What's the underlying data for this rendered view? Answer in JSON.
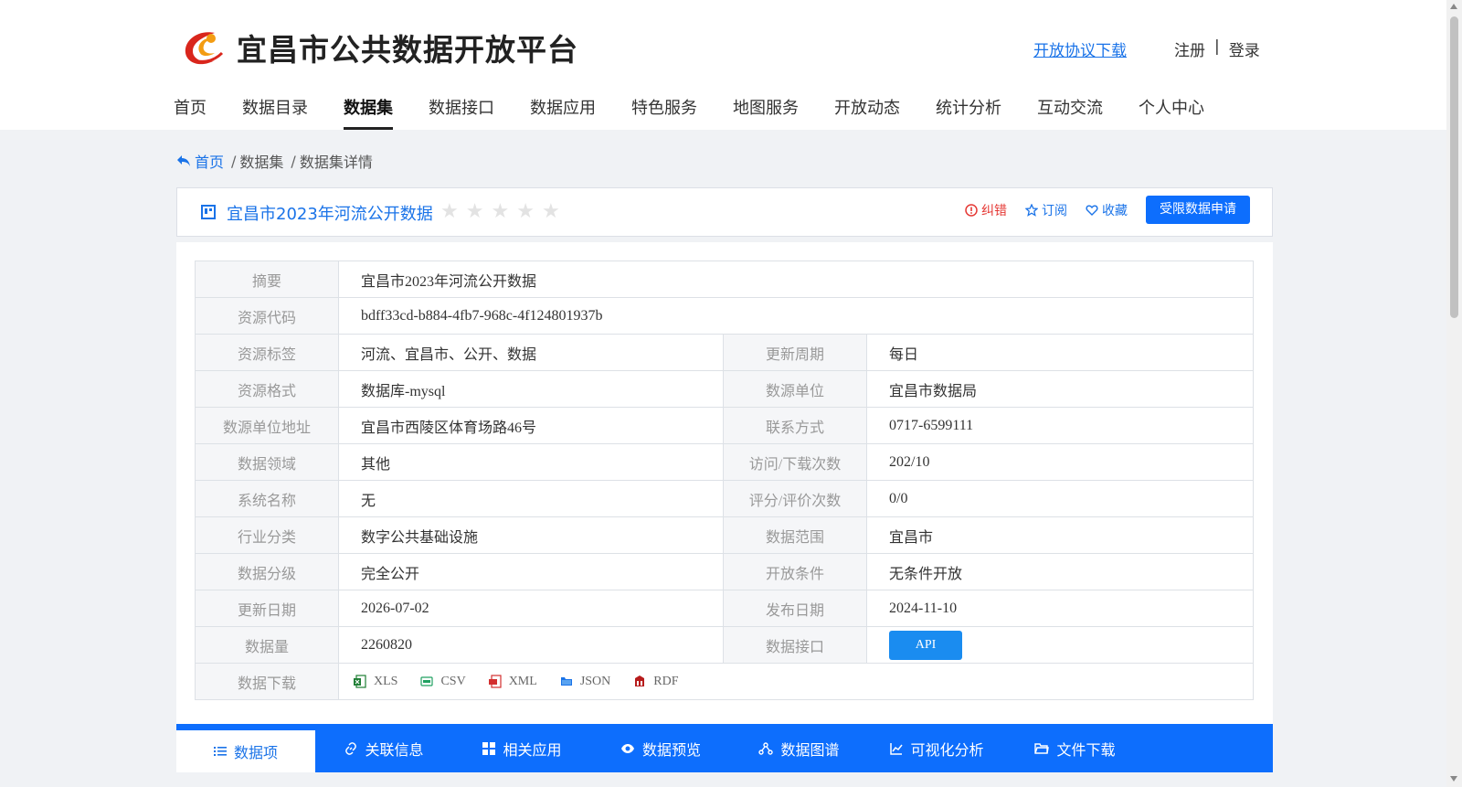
{
  "header": {
    "site_title": "宜昌市公共数据开放平台",
    "agreement_link": "开放协议下载",
    "register": "注册",
    "divider": "|",
    "login": "登录"
  },
  "nav": [
    {
      "label": "首页",
      "active": false
    },
    {
      "label": "数据目录",
      "active": false
    },
    {
      "label": "数据集",
      "active": true
    },
    {
      "label": "数据接口",
      "active": false
    },
    {
      "label": "数据应用",
      "active": false
    },
    {
      "label": "特色服务",
      "active": false
    },
    {
      "label": "地图服务",
      "active": false
    },
    {
      "label": "开放动态",
      "active": false
    },
    {
      "label": "统计分析",
      "active": false
    },
    {
      "label": "互动交流",
      "active": false
    },
    {
      "label": "个人中心",
      "active": false
    }
  ],
  "breadcrumb": {
    "home": "首页",
    "level1": "数据集",
    "level2": "数据集详情",
    "sep": "/"
  },
  "dataset": {
    "title": "宜昌市2023年河流公开数据",
    "rating_stars": 0,
    "actions": {
      "report": "纠错",
      "subscribe": "订阅",
      "favorite": "收藏",
      "apply": "受限数据申请"
    }
  },
  "info": {
    "summary": {
      "label": "摘要",
      "value": "宜昌市2023年河流公开数据"
    },
    "resource_code": {
      "label": "资源代码",
      "value": "bdff33cd-b884-4fb7-968c-4f124801937b"
    },
    "rows": [
      [
        {
          "label": "资源标签",
          "value": "河流、宜昌市、公开、数据"
        },
        {
          "label": "更新周期",
          "value": "每日"
        }
      ],
      [
        {
          "label": "资源格式",
          "value": "数据库-mysql"
        },
        {
          "label": "数源单位",
          "value": "宜昌市数据局"
        }
      ],
      [
        {
          "label": "数源单位地址",
          "value": "宜昌市西陵区体育场路46号"
        },
        {
          "label": "联系方式",
          "value": "0717-6599111"
        }
      ],
      [
        {
          "label": "数据领域",
          "value": "其他"
        },
        {
          "label": "访问/下载次数",
          "value": "202/10"
        }
      ],
      [
        {
          "label": "系统名称",
          "value": "无"
        },
        {
          "label": "评分/评价次数",
          "value": "0/0"
        }
      ],
      [
        {
          "label": "行业分类",
          "value": "数字公共基础设施"
        },
        {
          "label": "数据范围",
          "value": "宜昌市"
        }
      ],
      [
        {
          "label": "数据分级",
          "value": "完全公开"
        },
        {
          "label": "开放条件",
          "value": "无条件开放"
        }
      ],
      [
        {
          "label": "更新日期",
          "value": "2026-07-02"
        },
        {
          "label": "发布日期",
          "value": "2024-11-10"
        }
      ]
    ],
    "data_volume": {
      "label": "数据量",
      "value": "2260820"
    },
    "data_api": {
      "label": "数据接口",
      "button": "API"
    },
    "download": {
      "label": "数据下载",
      "formats": [
        {
          "name": "XLS",
          "icon": "xls-icon",
          "color": "#1e7e34"
        },
        {
          "name": "CSV",
          "icon": "csv-icon",
          "color": "#20a060"
        },
        {
          "name": "XML",
          "icon": "xml-icon",
          "color": "#d32f2f"
        },
        {
          "name": "JSON",
          "icon": "json-icon",
          "color": "#1a73e8"
        },
        {
          "name": "RDF",
          "icon": "rdf-icon",
          "color": "#b71c1c"
        }
      ]
    }
  },
  "tabs": [
    {
      "label": "数据项",
      "icon": "list-icon",
      "active": true
    },
    {
      "label": "关联信息",
      "icon": "link-icon",
      "active": false
    },
    {
      "label": "相关应用",
      "icon": "grid-icon",
      "active": false
    },
    {
      "label": "数据预览",
      "icon": "eye-icon",
      "active": false
    },
    {
      "label": "数据图谱",
      "icon": "graph-icon",
      "active": false
    },
    {
      "label": "可视化分析",
      "icon": "line-chart-icon",
      "active": false
    },
    {
      "label": "文件下载",
      "icon": "folder-icon",
      "active": false
    }
  ],
  "colors": {
    "primary": "#0d6efd",
    "link": "#1a73e8",
    "error": "#e53935"
  }
}
